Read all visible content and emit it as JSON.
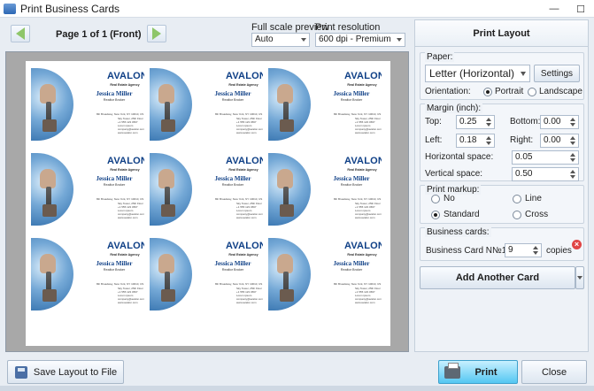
{
  "window": {
    "title": "Print Business Cards",
    "icon": "app-icon",
    "minimize": "—",
    "maximize": "☐"
  },
  "toolbar": {
    "page_label": "Page 1 of 1 (Front)",
    "full_scale_label": "Full scale preview",
    "full_scale_value": "Auto",
    "resolution_label": "Print resolution",
    "resolution_value": "600 dpi - Premium"
  },
  "card": {
    "logo": "AVALON",
    "tagline": "Real Estate Agency",
    "name": "Jessica Miller",
    "role": "Realtor Broker",
    "lines": [
      "8th Broadway, New York, NY 10010, US",
      "Sky Tower, 25th Floor",
      "+1 555 123 4567",
      "Lorem ipsum",
      "company@avalon.com",
      "www.avalon.com"
    ]
  },
  "panel": {
    "title": "Print Layout",
    "paper_title": "Paper:",
    "paper_value": "Letter (Horizontal)",
    "settings_label": "Settings",
    "orientation_label": "Orientation:",
    "portrait_label": "Portrait",
    "landscape_label": "Landscape",
    "margin_title": "Margin (inch):",
    "top_label": "Top:",
    "top_value": "0.25",
    "bottom_label": "Bottom:",
    "bottom_value": "0.00",
    "left_label": "Left:",
    "left_value": "0.18",
    "right_label": "Right:",
    "right_value": "0.00",
    "hspace_label": "Horizontal space:",
    "hspace_value": "0.05",
    "vspace_label": "Vertical space:",
    "vspace_value": "0.50",
    "markup_title": "Print markup:",
    "markup_no": "No",
    "markup_line": "Line",
    "markup_standard": "Standard",
    "markup_cross": "Cross",
    "cards_title": "Business cards:",
    "card_item_label": "Business Card N№1",
    "card_item_value": "9",
    "copies_label": "copies",
    "add_card_label": "Add Another Card"
  },
  "bottom": {
    "save_label": "Save Layout to File",
    "print_label": "Print",
    "close_label": "Close"
  }
}
